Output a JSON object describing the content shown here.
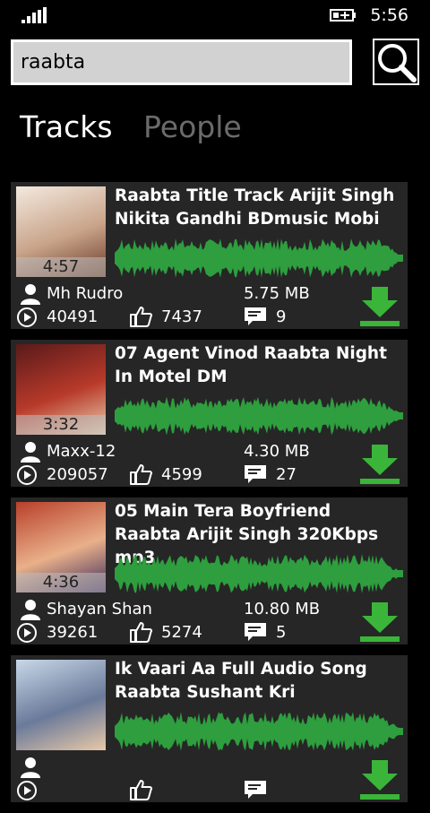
{
  "status": {
    "time": "5:56"
  },
  "search": {
    "value": "raabta",
    "placeholder": ""
  },
  "tabs": [
    {
      "label": "Tracks",
      "active": true
    },
    {
      "label": "People",
      "active": false
    }
  ],
  "colors": {
    "waveform": "#2e9e3e",
    "download": "#3ab53a",
    "card": "#262626",
    "inactive_tab": "#6b6b6b"
  },
  "tracks": [
    {
      "title": "Raabta Title Track Arijit Singh Nikita Gandhi BDmusic Mobi",
      "duration": "4:57",
      "uploader": "Mh Rudro",
      "size": "5.75 MB",
      "plays": "40491",
      "likes": "7437",
      "comments": "9"
    },
    {
      "title": "07 Agent Vinod Raabta Night In Motel DM",
      "duration": "3:32",
      "uploader": "Maxx-12",
      "size": "4.30 MB",
      "plays": "209057",
      "likes": "4599",
      "comments": "27"
    },
    {
      "title": "05 Main Tera Boyfriend Raabta Arijit Singh 320Kbps mp3",
      "duration": "4:36",
      "uploader": "Shayan Shan",
      "size": "10.80 MB",
      "plays": "39261",
      "likes": "5274",
      "comments": "5"
    },
    {
      "title": "Ik Vaari Aa Full Audio Song Raabta Sushant Kri",
      "duration": "",
      "uploader": "",
      "size": "",
      "plays": "",
      "likes": "",
      "comments": ""
    }
  ]
}
